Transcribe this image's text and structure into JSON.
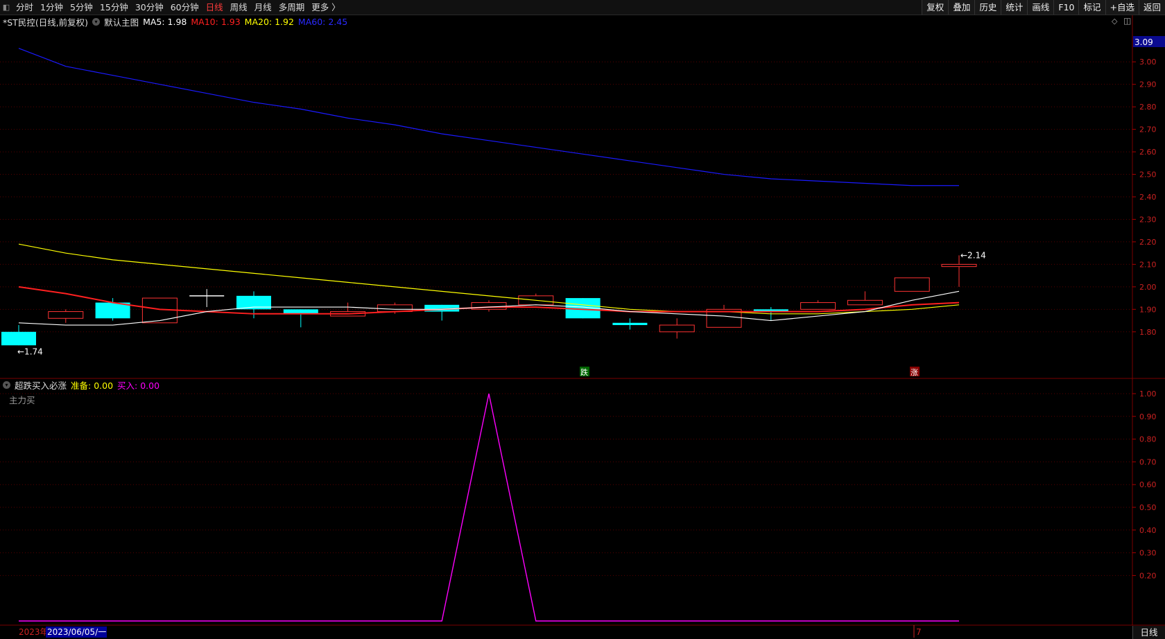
{
  "toolbar": {
    "periods": [
      "分时",
      "1分钟",
      "5分钟",
      "15分钟",
      "30分钟",
      "60分钟",
      "日线",
      "周线",
      "月线",
      "多周期",
      "更多 〉"
    ],
    "active_period": "日线",
    "tools": [
      "复权",
      "叠加",
      "历史",
      "统计",
      "画线",
      "F10",
      "标记",
      "+自选",
      "返回"
    ]
  },
  "main_legend": {
    "title": "*ST民控(日线,前复权)",
    "indicator_name": "默认主图",
    "ma5": "MA5: 1.98",
    "ma10": "MA10: 1.93",
    "ma20": "MA20: 1.92",
    "ma60": "MA60: 2.45"
  },
  "sub_legend": {
    "name": "超跌买入必涨",
    "zhunbei": "准备: 0.00",
    "mairu": "买入: 0.00",
    "label": "主力买"
  },
  "colors": {
    "up": "#ff3333",
    "down": "#00ffff",
    "ma5": "#ffffff",
    "ma10": "#ff2020",
    "ma20": "#ffff00",
    "ma60": "#1a1aff",
    "signal": "#ff00ff",
    "grid": "#5a0000"
  },
  "axis": {
    "main_current": "3.09",
    "main_ticks": [
      "3.00",
      "2.90",
      "2.80",
      "2.70",
      "2.60",
      "2.50",
      "2.40",
      "2.30",
      "2.20",
      "2.10",
      "2.00",
      "1.90",
      "1.80"
    ],
    "sub_ticks": [
      "1.00",
      "0.90",
      "0.80",
      "0.70",
      "0.60",
      "0.50",
      "0.40",
      "0.30",
      "0.20"
    ]
  },
  "markers": {
    "low_label": "←1.74",
    "high_label": "←2.14",
    "die": "跌",
    "zhang": "涨"
  },
  "bottom": {
    "year": "2023年",
    "date": "2023/06/05/一",
    "month_marker": "7",
    "period_label": "日线"
  },
  "chart_data": {
    "type": "candlestick",
    "price_range": [
      1.71,
      3.09
    ],
    "candles": [
      {
        "o": 1.8,
        "h": 1.83,
        "l": 1.74,
        "c": 1.74
      },
      {
        "o": 1.86,
        "h": 1.9,
        "l": 1.84,
        "c": 1.89
      },
      {
        "o": 1.93,
        "h": 1.95,
        "l": 1.85,
        "c": 1.86
      },
      {
        "o": 1.84,
        "h": 1.95,
        "l": 1.84,
        "c": 1.95
      },
      {
        "o": 1.96,
        "h": 1.99,
        "l": 1.91,
        "c": 1.96
      },
      {
        "o": 1.96,
        "h": 1.98,
        "l": 1.86,
        "c": 1.9
      },
      {
        "o": 1.9,
        "h": 1.9,
        "l": 1.82,
        "c": 1.88
      },
      {
        "o": 1.87,
        "h": 1.93,
        "l": 1.87,
        "c": 1.89
      },
      {
        "o": 1.89,
        "h": 1.93,
        "l": 1.88,
        "c": 1.92
      },
      {
        "o": 1.92,
        "h": 1.92,
        "l": 1.85,
        "c": 1.89
      },
      {
        "o": 1.9,
        "h": 1.94,
        "l": 1.89,
        "c": 1.93
      },
      {
        "o": 1.92,
        "h": 1.97,
        "l": 1.92,
        "c": 1.96
      },
      {
        "o": 1.95,
        "h": 1.95,
        "l": 1.86,
        "c": 1.86
      },
      {
        "o": 1.84,
        "h": 1.86,
        "l": 1.81,
        "c": 1.83
      },
      {
        "o": 1.8,
        "h": 1.86,
        "l": 1.77,
        "c": 1.83
      },
      {
        "o": 1.82,
        "h": 1.92,
        "l": 1.82,
        "c": 1.9
      },
      {
        "o": 1.9,
        "h": 1.91,
        "l": 1.85,
        "c": 1.89
      },
      {
        "o": 1.9,
        "h": 1.94,
        "l": 1.9,
        "c": 1.93
      },
      {
        "o": 1.92,
        "h": 1.98,
        "l": 1.92,
        "c": 1.94
      },
      {
        "o": 1.98,
        "h": 2.04,
        "l": 1.98,
        "c": 2.04
      },
      {
        "o": 2.09,
        "h": 2.14,
        "l": 2.0,
        "c": 2.1
      }
    ],
    "ma5": [
      1.84,
      1.83,
      1.83,
      1.85,
      1.89,
      1.91,
      1.91,
      1.91,
      1.9,
      1.9,
      1.91,
      1.92,
      1.91,
      1.89,
      1.88,
      1.87,
      1.85,
      1.87,
      1.89,
      1.94,
      1.98
    ],
    "ma10": [
      2.0,
      1.97,
      1.93,
      1.9,
      1.89,
      1.88,
      1.88,
      1.88,
      1.89,
      1.9,
      1.91,
      1.91,
      1.9,
      1.89,
      1.89,
      1.89,
      1.89,
      1.89,
      1.9,
      1.92,
      1.93
    ],
    "ma20": [
      2.19,
      2.15,
      2.12,
      2.1,
      2.08,
      2.06,
      2.04,
      2.02,
      2.0,
      1.98,
      1.96,
      1.94,
      1.92,
      1.9,
      1.89,
      1.89,
      1.88,
      1.88,
      1.89,
      1.9,
      1.92
    ],
    "ma60": [
      3.06,
      2.98,
      2.94,
      2.9,
      2.86,
      2.82,
      2.79,
      2.75,
      2.72,
      2.68,
      2.65,
      2.62,
      2.59,
      2.56,
      2.53,
      2.5,
      2.48,
      2.47,
      2.46,
      2.45,
      2.45
    ],
    "signal": [
      0,
      0,
      0,
      0,
      0,
      0,
      0,
      0,
      0,
      0,
      1.0,
      0,
      0,
      0,
      0,
      0,
      0,
      0,
      0,
      0,
      0
    ],
    "signal_range": [
      0,
      1.0
    ]
  }
}
